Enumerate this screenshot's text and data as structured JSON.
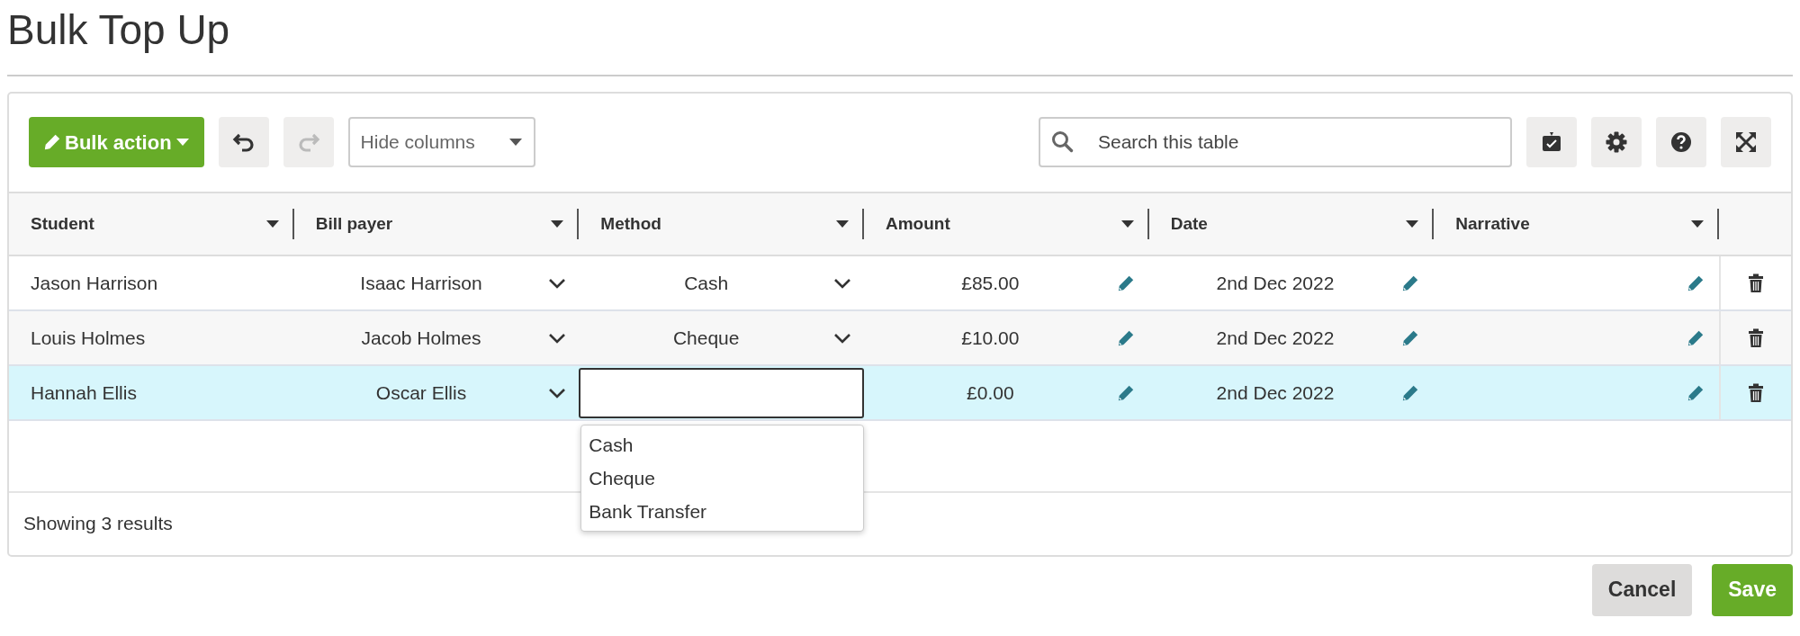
{
  "page_title": "Bulk Top Up",
  "toolbar": {
    "bulk_action": "Bulk action",
    "undo": {
      "disabled": false
    },
    "redo": {
      "disabled": true
    },
    "hide_columns": "Hide columns",
    "search": {
      "placeholder": "Search this table"
    }
  },
  "table": {
    "columns": [
      "Student",
      "Bill payer",
      "Method",
      "Amount",
      "Date",
      "Narrative"
    ],
    "rows": [
      {
        "student": "Jason Harrison",
        "bill_payer": "Isaac Harrison",
        "method_editing": false,
        "method": "Cash",
        "amount": "£85.00",
        "date": "2nd Dec 2022",
        "selected": false
      },
      {
        "student": "Louis Holmes",
        "bill_payer": "Jacob Holmes",
        "method_editing": false,
        "method": "Cheque",
        "amount": "£10.00",
        "date": "2nd Dec 2022",
        "selected": false
      },
      {
        "student": "Hannah Ellis",
        "bill_payer": "Oscar Ellis",
        "method_editing": true,
        "method_options": [
          "Cash",
          "Cheque",
          "Bank Transfer"
        ],
        "amount": "£0.00",
        "date": "2nd Dec 2022",
        "selected": true
      }
    ]
  },
  "footer": "Showing 3 results",
  "actions": [
    {
      "label": "Cancel",
      "kind": "secondary"
    },
    {
      "label": "Save",
      "kind": "primary"
    }
  ]
}
